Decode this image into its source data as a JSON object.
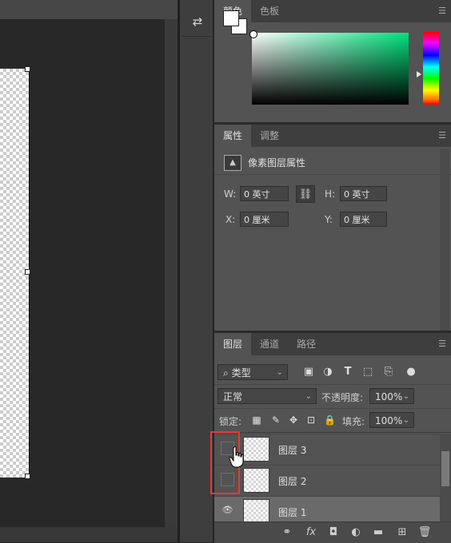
{
  "color_panel": {
    "tabs": [
      "颜色",
      "色板"
    ],
    "fg_color": "#ffffff",
    "bg_color": "#ffffff",
    "hue_color": "#00e17c"
  },
  "properties_panel": {
    "tabs": [
      "属性",
      "调整"
    ],
    "title": "像素图层属性",
    "w_label": "W:",
    "w_value": "0 英寸",
    "h_label": "H:",
    "h_value": "0 英寸",
    "x_label": "X:",
    "x_value": "0 厘米",
    "y_label": "Y:",
    "y_value": "0 厘米"
  },
  "layers_panel": {
    "tabs": [
      "图层",
      "通道",
      "路径"
    ],
    "filter_kind": "类型",
    "blend_mode": "正常",
    "opacity_label": "不透明度:",
    "opacity_value": "100%",
    "lock_label": "锁定:",
    "fill_label": "填充:",
    "fill_value": "100%",
    "layers": [
      {
        "name": "图层 3",
        "visible": false,
        "selected": false
      },
      {
        "name": "图层 2",
        "visible": false,
        "selected": false
      },
      {
        "name": "图层 1",
        "visible": true,
        "selected": true
      }
    ],
    "bottom_icons": [
      "link-icon",
      "fx-icon",
      "mask-icon",
      "adjustment-icon",
      "folder-icon",
      "new-layer-icon",
      "trash-icon"
    ]
  }
}
